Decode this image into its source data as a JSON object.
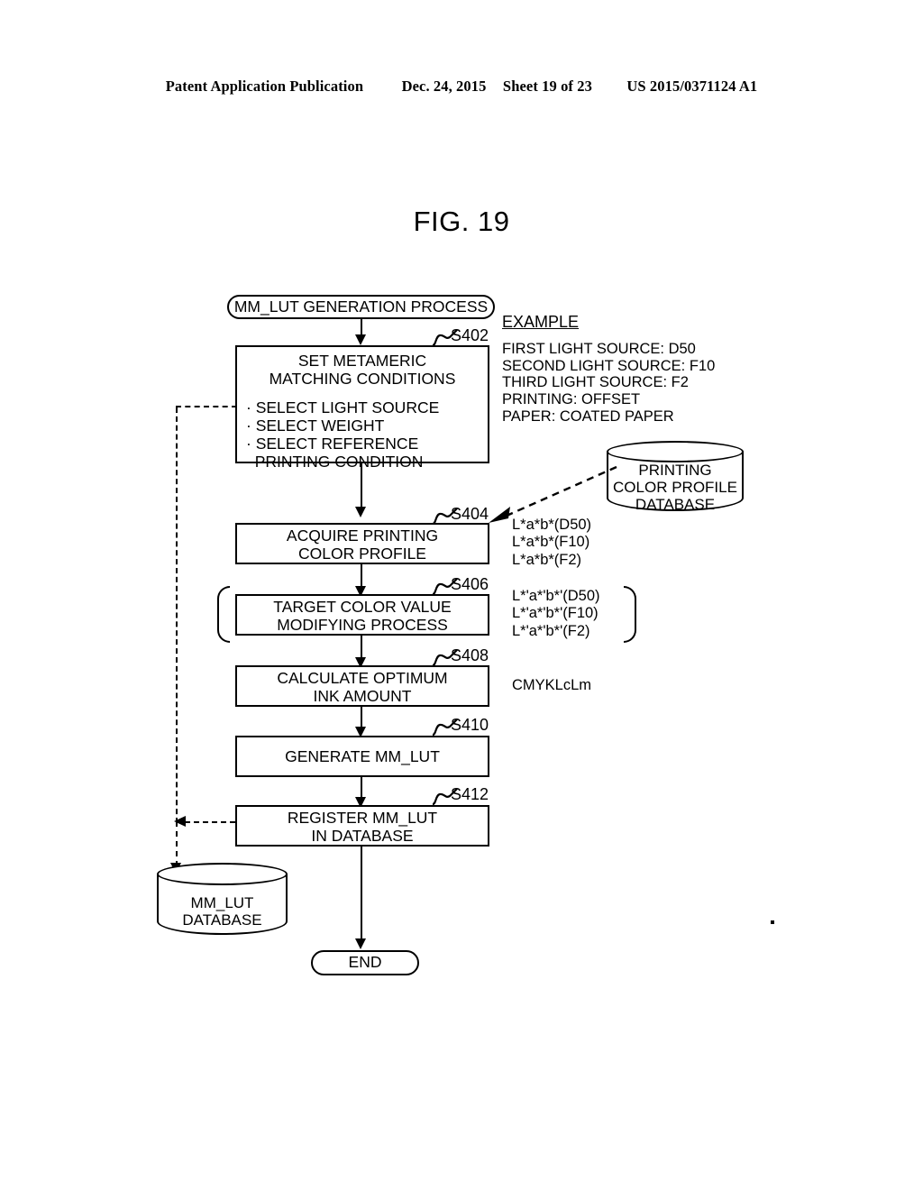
{
  "header": {
    "left": "Patent Application Publication",
    "date": "Dec. 24, 2015",
    "sheet": "Sheet 19 of 23",
    "pubnum": "US 2015/0371124 A1"
  },
  "figure": {
    "title": "FIG. 19"
  },
  "flowchart": {
    "start": "MM_LUT GENERATION PROCESS",
    "end": "END",
    "steps": [
      {
        "id": "S402",
        "label": "S402",
        "title_line1": "SET METAMERIC",
        "title_line2": "MATCHING CONDITIONS",
        "bullets": [
          "· SELECT LIGHT SOURCE",
          "· SELECT WEIGHT",
          "· SELECT REFERENCE",
          "  PRINTING CONDITION"
        ]
      },
      {
        "id": "S404",
        "label": "S404",
        "title_line1": "ACQUIRE PRINTING",
        "title_line2": "COLOR PROFILE"
      },
      {
        "id": "S406",
        "label": "S406",
        "title_line1": "TARGET COLOR VALUE",
        "title_line2": "MODIFYING PROCESS"
      },
      {
        "id": "S408",
        "label": "S408",
        "title_line1": "CALCULATE OPTIMUM",
        "title_line2": "INK AMOUNT"
      },
      {
        "id": "S410",
        "label": "S410",
        "title_line1": "GENERATE MM_LUT",
        "title_line2": ""
      },
      {
        "id": "S412",
        "label": "S412",
        "title_line1": "REGISTER MM_LUT",
        "title_line2": "IN DATABASE"
      }
    ]
  },
  "annotations": {
    "example_heading": "EXAMPLE",
    "example_body": "FIRST LIGHT SOURCE: D50\nSECOND LIGHT SOURCE: F10\nTHIRD LIGHT SOURCE: F2\nPRINTING: OFFSET\nPAPER: COATED PAPER",
    "lab_values": "L*a*b*(D50)\nL*a*b*(F10)\nL*a*b*(F2)",
    "lab_modified": "L*'a*'b*'(D50)\nL*'a*'b*'(F10)\nL*'a*'b*'(F2)",
    "ink_channels": "CMYKLcLm"
  },
  "databases": {
    "printing_profile": {
      "line1": "PRINTING",
      "line2": "COLOR PROFILE",
      "line3": "DATABASE"
    },
    "mm_lut": {
      "line1": "MM_LUT",
      "line2": "DATABASE",
      "line3": ""
    }
  },
  "colors": {
    "ink": "#000000",
    "paper": "#ffffff"
  }
}
